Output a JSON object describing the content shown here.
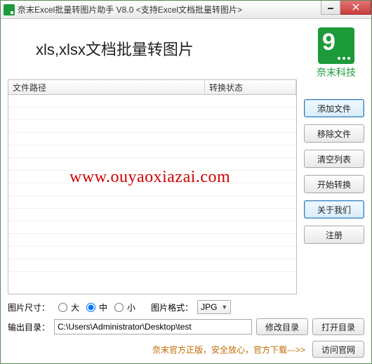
{
  "window": {
    "title": "奈末Excel批量转图片助手 V8.0   <支持Excel文档批量转图片>"
  },
  "heading": "xls,xlsx文档批量转图片",
  "logo": {
    "brand": "奈末科技"
  },
  "table": {
    "col_path": "文件路径",
    "col_status": "转换状态"
  },
  "buttons": {
    "add_file": "添加文件",
    "remove_file": "移除文件",
    "clear_list": "清空列表",
    "start_convert": "开始转换",
    "about_us": "关于我们",
    "register": "注册",
    "modify_dir": "修改目录",
    "open_dir": "打开目录",
    "visit_site": "访问官网"
  },
  "image_size": {
    "label": "图片尺寸：",
    "opt_large": "大",
    "opt_medium": "中",
    "opt_small": "小",
    "selected": "medium"
  },
  "image_format": {
    "label": "图片格式：",
    "value": "JPG"
  },
  "output": {
    "label": "输出目录：",
    "path": "C:\\Users\\Administrator\\Desktop\\test"
  },
  "footer": {
    "notice": "奈末官方正版，安全放心，官方下载--->>"
  },
  "watermark": "www.ouyaoxiazai.com"
}
